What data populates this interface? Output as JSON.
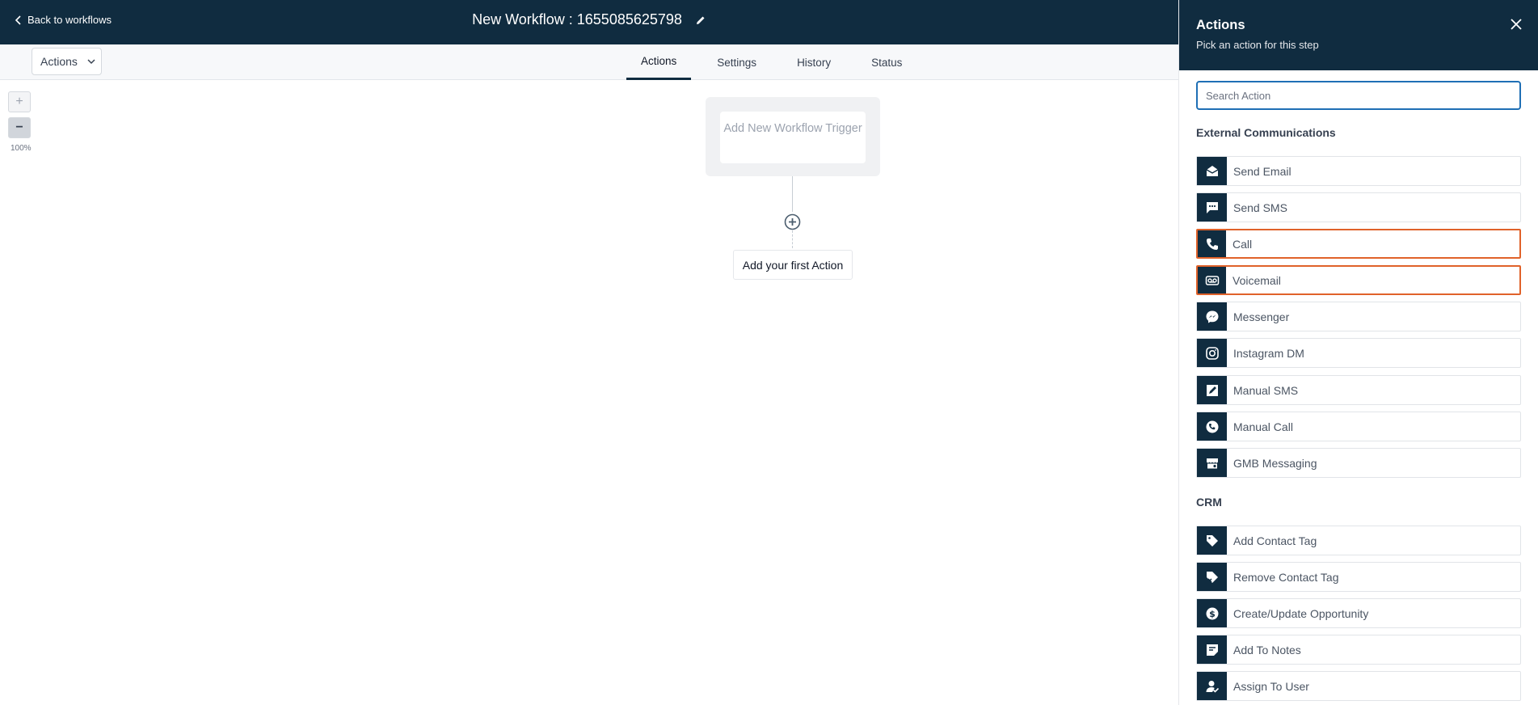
{
  "header": {
    "back_label": "Back to workflows",
    "workflow_title": "New Workflow : 1655085625798"
  },
  "toolbar": {
    "actions_dropdown": "Actions",
    "tabs": [
      {
        "label": "Actions",
        "active": true
      },
      {
        "label": "Settings",
        "active": false
      },
      {
        "label": "History",
        "active": false
      },
      {
        "label": "Status",
        "active": false
      }
    ]
  },
  "zoom": {
    "plus": "+",
    "minus": "−",
    "level": "100%"
  },
  "canvas": {
    "trigger_label": "Add New Workflow Trigger",
    "first_action_label": "Add your first Action"
  },
  "panel": {
    "title": "Actions",
    "subtitle": "Pick an action for this step",
    "search_placeholder": "Search Action",
    "sections": [
      {
        "title": "External Communications",
        "items": [
          {
            "label": "Send Email",
            "icon": "email-icon",
            "highlighted": false
          },
          {
            "label": "Send SMS",
            "icon": "sms-icon",
            "highlighted": false
          },
          {
            "label": "Call",
            "icon": "phone-icon",
            "highlighted": true
          },
          {
            "label": "Voicemail",
            "icon": "voicemail-icon",
            "highlighted": true
          },
          {
            "label": "Messenger",
            "icon": "messenger-icon",
            "highlighted": false
          },
          {
            "label": "Instagram DM",
            "icon": "instagram-icon",
            "highlighted": false
          },
          {
            "label": "Manual SMS",
            "icon": "manual-sms-icon",
            "highlighted": false
          },
          {
            "label": "Manual Call",
            "icon": "manual-call-icon",
            "highlighted": false
          },
          {
            "label": "GMB Messaging",
            "icon": "gmb-icon",
            "highlighted": false
          }
        ]
      },
      {
        "title": "CRM",
        "items": [
          {
            "label": "Add Contact Tag",
            "icon": "tag-icon",
            "highlighted": false
          },
          {
            "label": "Remove Contact Tag",
            "icon": "remove-tag-icon",
            "highlighted": false
          },
          {
            "label": "Create/Update Opportunity",
            "icon": "dollar-icon",
            "highlighted": false
          },
          {
            "label": "Add To Notes",
            "icon": "notes-icon",
            "highlighted": false
          },
          {
            "label": "Assign To User",
            "icon": "assign-user-icon",
            "highlighted": false
          }
        ]
      }
    ]
  },
  "colors": {
    "navy": "#102c40",
    "highlight": "#e0622a",
    "search_border": "#1f6fb5"
  }
}
